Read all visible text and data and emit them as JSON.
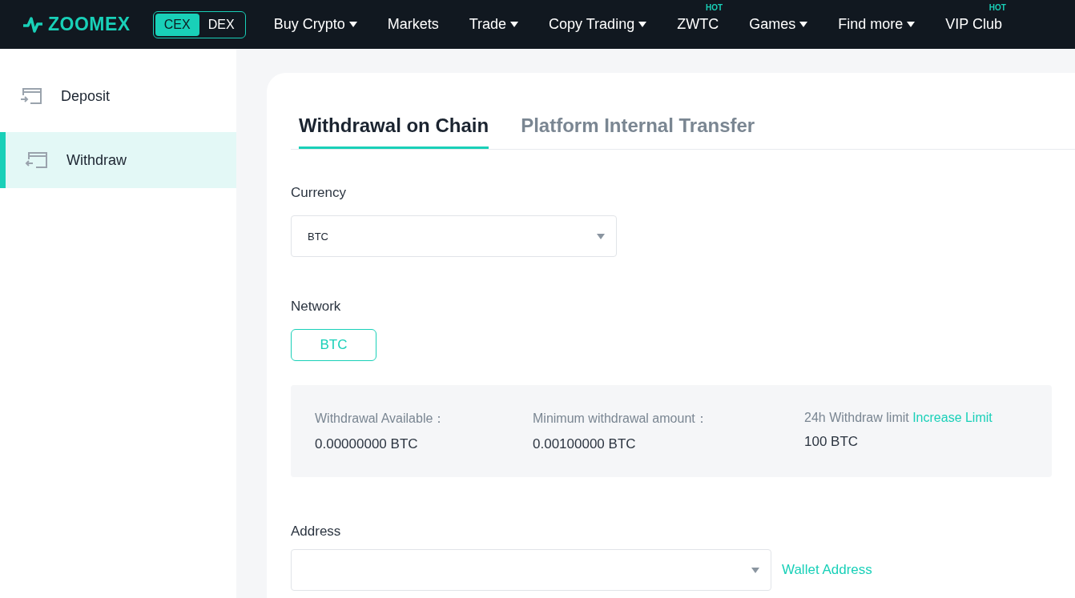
{
  "header": {
    "logo": "ZOOMEX",
    "mode_switch": [
      {
        "label": "CEX",
        "selected": true
      },
      {
        "label": "DEX",
        "selected": false
      }
    ],
    "nav": [
      {
        "label": "Buy Crypto",
        "dropdown": true
      },
      {
        "label": "Markets",
        "dropdown": false
      },
      {
        "label": "Trade",
        "dropdown": true
      },
      {
        "label": "Copy Trading",
        "dropdown": true
      },
      {
        "label": "ZWTC",
        "dropdown": false,
        "badge": "HOT"
      },
      {
        "label": "Games",
        "dropdown": true
      },
      {
        "label": "Find more",
        "dropdown": true
      },
      {
        "label": "VIP Club",
        "dropdown": false,
        "badge": "HOT"
      }
    ]
  },
  "sidebar": {
    "items": [
      {
        "label": "Deposit",
        "kind": "deposit",
        "selected": false
      },
      {
        "label": "Withdraw",
        "kind": "withdraw",
        "selected": true
      }
    ]
  },
  "tabs": [
    {
      "label": "Withdrawal on Chain",
      "selected": true
    },
    {
      "label": "Platform Internal Transfer",
      "selected": false
    }
  ],
  "currency": {
    "label": "Currency",
    "value": "BTC"
  },
  "network": {
    "label": "Network",
    "options": [
      {
        "label": "BTC",
        "selected": true
      }
    ]
  },
  "info": [
    {
      "label": "Withdrawal Available：",
      "value": "0.00000000 BTC"
    },
    {
      "label": "Minimum withdrawal amount：",
      "value": "0.00100000 BTC"
    },
    {
      "label": "24h Withdraw limit",
      "link": "Increase Limit",
      "value": "100 BTC"
    }
  ],
  "address": {
    "label": "Address",
    "link": "Wallet Address"
  }
}
